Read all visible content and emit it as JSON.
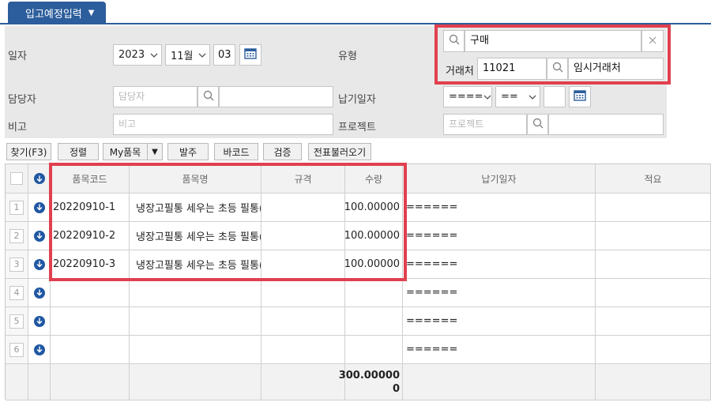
{
  "tab": {
    "title": "입고예정입력"
  },
  "form": {
    "date_label": "일자",
    "year": "2023",
    "month": "11월",
    "day": "03",
    "type_label": "유형",
    "type_value": "구매",
    "vendor_label": "거래처",
    "vendor_code": "11021",
    "vendor_name": "임시거래처",
    "manager_label": "담당자",
    "manager_placeholder": "담당자",
    "due_label": "납기일자",
    "due_sel1": "====",
    "due_sel2": "==",
    "remark_label": "비고",
    "remark_placeholder": "비고",
    "project_label": "프로젝트",
    "project_placeholder": "프로젝트"
  },
  "toolbar": {
    "find": "찾기(F3)",
    "sort": "정렬",
    "my_items": "My품목",
    "order": "발주",
    "barcode": "바코드",
    "verify": "검증",
    "load_slip": "전표불러오기"
  },
  "grid": {
    "columns": [
      "품목코드",
      "품목명",
      "규격",
      "수량",
      "납기일자",
      "적요"
    ],
    "rows": [
      {
        "num": "1",
        "code": "20220910-1",
        "name": "냉장고필통 세우는 초등 필통(투",
        "spec": "",
        "qty": "100.00000",
        "due": "======",
        "note": ""
      },
      {
        "num": "2",
        "code": "20220910-2",
        "name": "냉장고필통 세우는 초등 필통(투",
        "spec": "",
        "qty": "100.00000",
        "due": "======",
        "note": ""
      },
      {
        "num": "3",
        "code": "20220910-3",
        "name": "냉장고필통 세우는 초등 필통(투",
        "spec": "",
        "qty": "100.00000",
        "due": "======",
        "note": ""
      },
      {
        "num": "4",
        "code": "",
        "name": "",
        "spec": "",
        "qty": "",
        "due": "======",
        "note": ""
      },
      {
        "num": "5",
        "code": "",
        "name": "",
        "spec": "",
        "qty": "",
        "due": "======",
        "note": ""
      },
      {
        "num": "6",
        "code": "",
        "name": "",
        "spec": "",
        "qty": "",
        "due": "======",
        "note": ""
      }
    ],
    "total_qty_line1": "300.00000",
    "total_qty_line2": "0"
  },
  "colors": {
    "accent": "#2c5d9c",
    "highlight": "#e0404f",
    "download_icon": "#1f57a3"
  }
}
